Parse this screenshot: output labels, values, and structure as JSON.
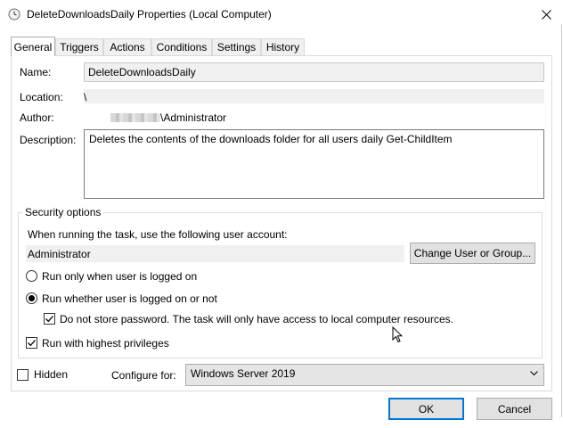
{
  "window": {
    "title": "DeleteDownloadsDaily Properties (Local Computer)"
  },
  "tabs": [
    "General",
    "Triggers",
    "Actions",
    "Conditions",
    "Settings",
    "History"
  ],
  "general": {
    "name_label": "Name:",
    "name_value": "DeleteDownloadsDaily",
    "location_label": "Location:",
    "location_value": "\\",
    "author_label": "Author:",
    "author_value": "\\Administrator",
    "description_label": "Description:",
    "description_value": "Deletes the contents of the downloads folder for all users daily Get-ChildItem"
  },
  "security": {
    "title": "Security options",
    "account_prompt": "When running the task, use the following user account:",
    "account_value": "Administrator",
    "change_button": "Change User or Group...",
    "radio_logged_on": "Run only when user is logged on",
    "radio_whether": "Run whether user is logged on or not",
    "radio_selected": "whether",
    "no_store_password": "Do not store password.  The task will only have access to local computer resources.",
    "no_store_password_checked": true,
    "highest_privileges": "Run with highest privileges",
    "highest_privileges_checked": true
  },
  "bottom": {
    "hidden_label": "Hidden",
    "hidden_checked": false,
    "configure_label": "Configure for:",
    "configure_value": "Windows Server 2019"
  },
  "buttons": {
    "ok": "OK",
    "cancel": "Cancel"
  },
  "colors": {
    "accent": "#0078d7",
    "button_bg": "#e1e1e1",
    "readonly_bg": "#f0f0f0"
  }
}
